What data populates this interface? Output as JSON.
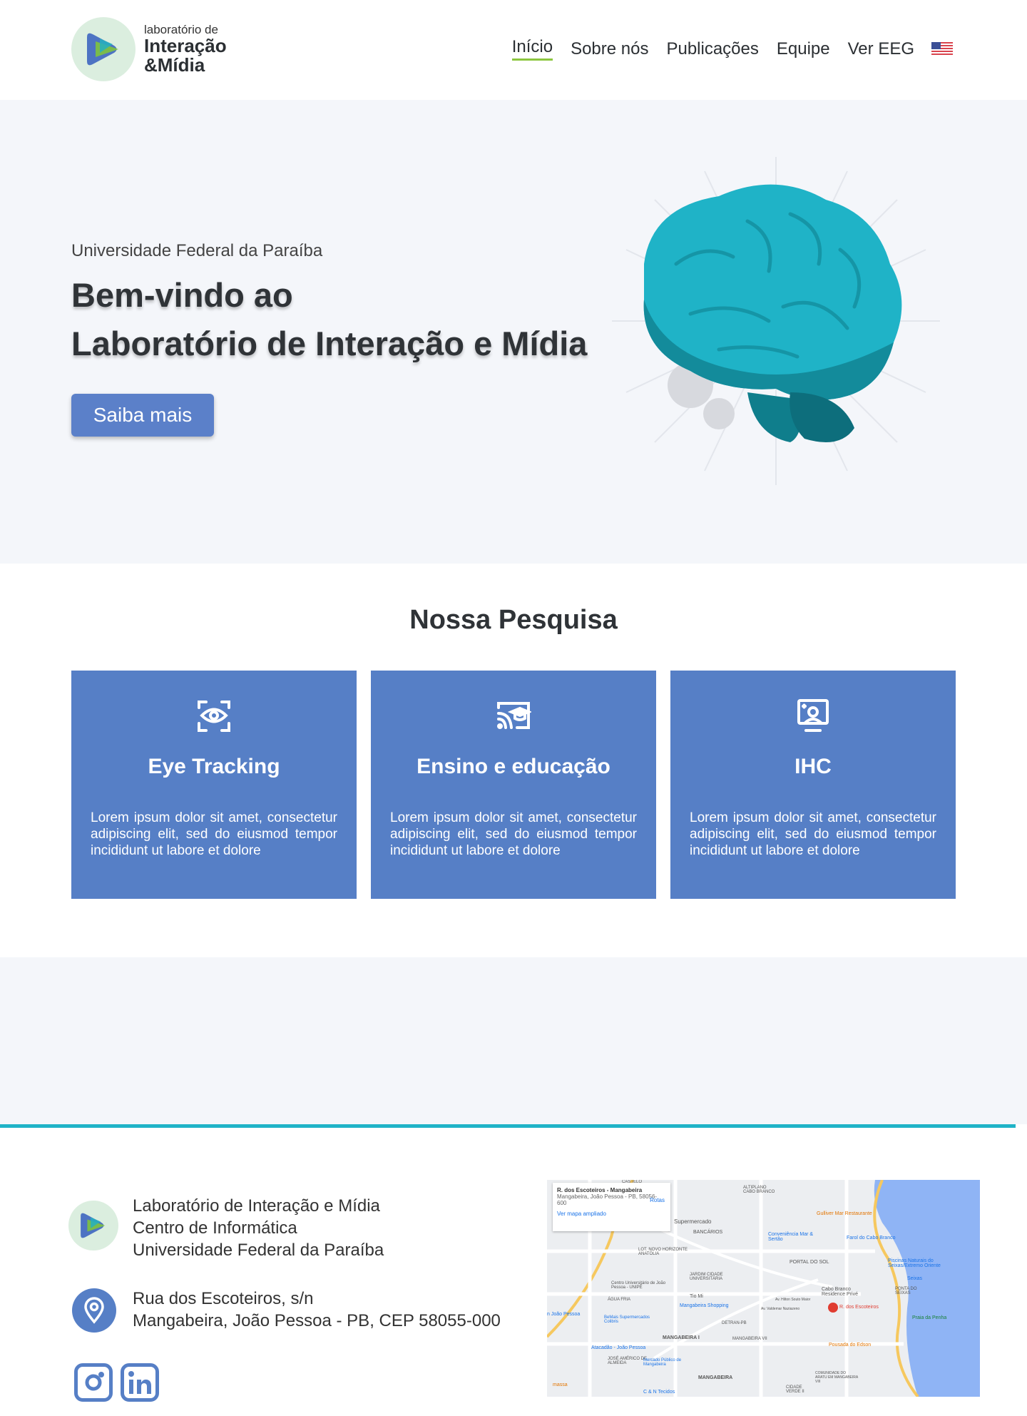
{
  "header": {
    "logo": {
      "line1": "laboratório de",
      "line2": "Interação",
      "line3": "&Mídia"
    },
    "nav": [
      {
        "label": "Início",
        "active": true
      },
      {
        "label": "Sobre nós",
        "active": false
      },
      {
        "label": "Publicações",
        "active": false
      },
      {
        "label": "Equipe",
        "active": false
      },
      {
        "label": "Ver EEG",
        "active": false
      }
    ],
    "language_icon": "us-flag-icon"
  },
  "hero": {
    "subtitle": "Universidade Federal da Paraíba",
    "title_line1": "Bem-vindo ao",
    "title_line2": "Laboratório de Interação e Mídia",
    "button_label": "Saiba mais",
    "illustration": "brain-illustration"
  },
  "research": {
    "title": "Nossa Pesquisa",
    "cards": [
      {
        "icon": "eye-scan-icon",
        "title": "Eye Tracking",
        "text": "Lorem ipsum dolor sit amet, consectetur adipiscing elit, sed do eiusmod tempor incididunt ut labore et dolore"
      },
      {
        "icon": "education-screen-icon",
        "title": "Ensino e educação",
        "text": "Lorem ipsum dolor sit amet, consectetur adipiscing elit, sed do eiusmod tempor incididunt ut labore et dolore"
      },
      {
        "icon": "user-screen-icon",
        "title": "IHC",
        "text": "Lorem ipsum dolor sit amet, consectetur adipiscing elit, sed do eiusmod tempor incididunt ut labore et dolore"
      }
    ]
  },
  "footer": {
    "org_line1": "Laboratório de Interação e Mídia",
    "org_line2": "Centro de Informática",
    "org_line3": "Universidade Federal da Paraíba",
    "addr_line1": "Rua dos Escoteiros, s/n",
    "addr_line2": "Mangabeira, João Pessoa - PB, CEP 58055-000",
    "social": [
      "instagram-icon",
      "linkedin-icon"
    ],
    "map": {
      "card_title": "R. dos Escoteiros - Mangabeira",
      "card_addr": "Mangabeira, João Pessoa - PB, 58056-600",
      "card_link": "Ver mapa ampliado",
      "card_route": "Rotas",
      "labels": [
        "Supermercado",
        "BANCÁRIOS",
        "Conveniência Mar & Sertão",
        "Farol do Cabo Branco",
        "Gulliver Mar Restaurante",
        "PORTAL DO SOL",
        "Piscinas Naturais do Seixas/Extremo Oriente",
        "Seixas",
        "LOT. NOVO HORIZONTE ANATÓLIA",
        "JARDIM CIDADE UNIVERSITÁRIA",
        "Centro Universitário de João Pessoa - UNIPÊ",
        "ÁGUA FRIA",
        "Tio Mi",
        "Cabo Branco Residence Privé",
        "PONTA DO SEIXAS",
        "Mangabeira Shopping",
        "R. dos Escoteiros",
        "Praia da Penha",
        "n João Pessoa",
        "BeMais Supermercados Colibris",
        "DETRAN-PB",
        "MANGABEIRA I",
        "MANGABEIRA VII",
        "Atacadão - João Pessoa",
        "JOSÉ AMÉRICO DE ALMEIDA",
        "Mercado Público de Mangabeira",
        "Pousada do Edson",
        "MANGABEIRA",
        "COMUNIDADE DO ARATU EM MANGABEIRA VIII",
        "CIDADE VERDE II",
        "C & N Tecidos",
        "massa",
        "CASTELO",
        "ALTIPLANO CABO BRANCO",
        "Av. Valdemar Naziazeno",
        "Av. Hilton Souto Maior"
      ]
    }
  },
  "colors": {
    "accent": "#567fc6",
    "nav_underline": "#8cc640",
    "footer_line": "#1fb3c7",
    "hero_bg": "#f4f6fa"
  }
}
